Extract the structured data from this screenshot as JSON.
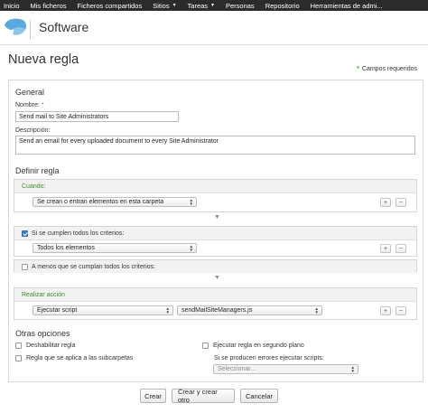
{
  "topnav": {
    "items": [
      {
        "label": "Inicio",
        "dropdown": false
      },
      {
        "label": "Mis ficheros",
        "dropdown": false
      },
      {
        "label": "Ficheros compartidos",
        "dropdown": false
      },
      {
        "label": "Sitios",
        "dropdown": true
      },
      {
        "label": "Tareas",
        "dropdown": true
      },
      {
        "label": "Personas",
        "dropdown": false
      },
      {
        "label": "Repositorio",
        "dropdown": false
      },
      {
        "label": "Herramientas de admi...",
        "dropdown": false
      }
    ]
  },
  "header": {
    "title": "Software",
    "logo_icon": "alfresco-logo-icon"
  },
  "page": {
    "title": "Nueva regla",
    "required_note": "Campos requeridos",
    "required_marker": "*"
  },
  "general": {
    "title": "General",
    "name_label": "Nombre:",
    "name_value": "Send mail to Site Administrators",
    "description_label": "Descripción:",
    "description_value": "Send an email for every uploaded document to every Site Administrator"
  },
  "define": {
    "title": "Definir regla",
    "when": {
      "header": "Cuando:",
      "select_value": "Se crean o entran elementos en esta carpeta"
    },
    "if_all": {
      "header": "Si se cumplen todos los criterios:",
      "checked": true,
      "select_value": "Todos los elementos"
    },
    "unless": {
      "header": "A menos que se cumplan todos los criterios:",
      "checked": false
    },
    "action": {
      "header": "Realizar acción",
      "select_value": "Ejecutar script",
      "script_value": "sendMailSiteManagers.js"
    },
    "add_symbol": "+",
    "remove_symbol": "−",
    "flow_arrow": "▼"
  },
  "other": {
    "title": "Otras opciones",
    "disable_label": "Deshabilitar regla",
    "background_label": "Ejecutar regla en segundo plano",
    "subfolders_label": "Regla que se aplica a las subcarpetas",
    "error_script_label": "Si se producen errores ejecutar scripts:",
    "error_script_placeholder": "Seleccionar..."
  },
  "buttons": {
    "create": "Crear",
    "create_another": "Crear y crear otro",
    "cancel": "Cancelar"
  },
  "colors": {
    "topnav_bg": "#2b2b2b",
    "accent_green": "#3a8a2a",
    "logo_blue": "#5aa9dc",
    "checkbox_blue": "#3a7bd5"
  }
}
